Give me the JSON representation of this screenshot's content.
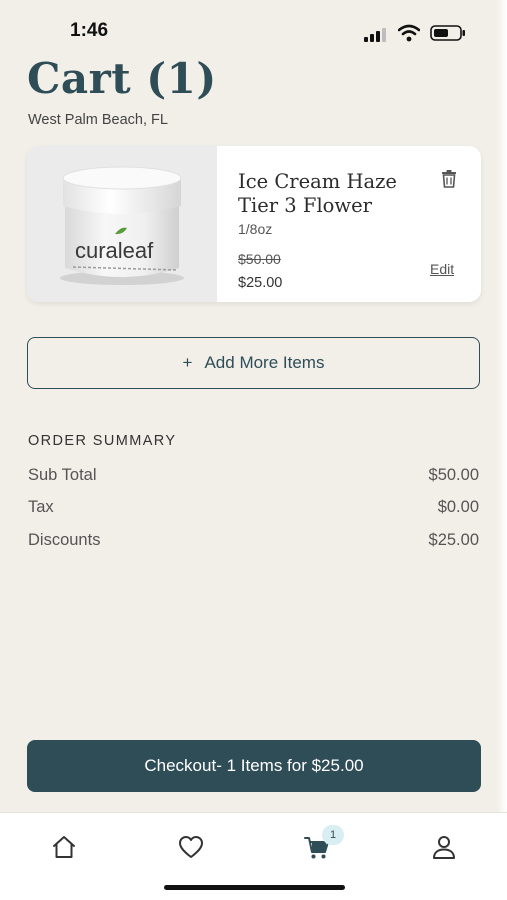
{
  "status_bar": {
    "time": "1:46"
  },
  "header": {
    "title": "Cart (1)",
    "location": "West Palm Beach, FL"
  },
  "cart_item": {
    "brand_on_image": "curaleaf",
    "name_line1": "Ice Cream Haze",
    "name_line2": "Tier 3 Flower",
    "size": "1/8oz",
    "original_price": "$50.00",
    "price": "$25.00",
    "edit_label": "Edit",
    "delete_icon": "trash-icon"
  },
  "add_more": {
    "plus": "+",
    "label": "Add More Items"
  },
  "order_summary": {
    "heading": "ORDER SUMMARY",
    "rows": [
      {
        "label": "Sub Total",
        "value": "$50.00"
      },
      {
        "label": "Tax",
        "value": "$0.00"
      },
      {
        "label": "Discounts",
        "value": "$25.00"
      }
    ]
  },
  "checkout": {
    "label": "Checkout- 1 Items for $25.00"
  },
  "tab_bar": {
    "tabs": [
      {
        "icon": "home-icon"
      },
      {
        "icon": "heart-icon"
      },
      {
        "icon": "cart-icon",
        "badge": "1"
      },
      {
        "icon": "profile-icon"
      }
    ]
  },
  "colors": {
    "background": "#f2efe9",
    "primary": "#2f4d57",
    "badge": "#d8eef2"
  }
}
